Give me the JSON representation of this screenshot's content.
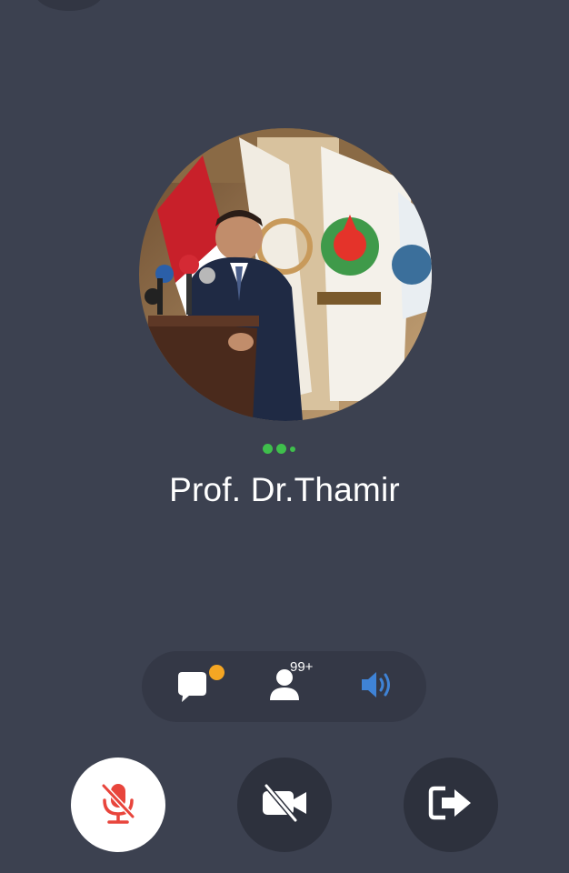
{
  "caller": {
    "name": "Prof. Dr.Thamir"
  },
  "controls_bar": {
    "participants_count": "99+",
    "chat_has_unread": true
  },
  "colors": {
    "background": "#3c4150",
    "pill_background": "#343846",
    "dark_button": "#2d313d",
    "accent_green": "#3fbf4c",
    "unread_orange": "#f5a623",
    "mute_red": "#e8453c",
    "speaker_blue": "#3f83d6"
  },
  "icons": {
    "chat": "chat-bubble-icon",
    "participants": "person-icon",
    "speaker": "speaker-icon",
    "mic": "mic-muted-icon",
    "camera": "camera-off-icon",
    "leave": "exit-icon"
  }
}
